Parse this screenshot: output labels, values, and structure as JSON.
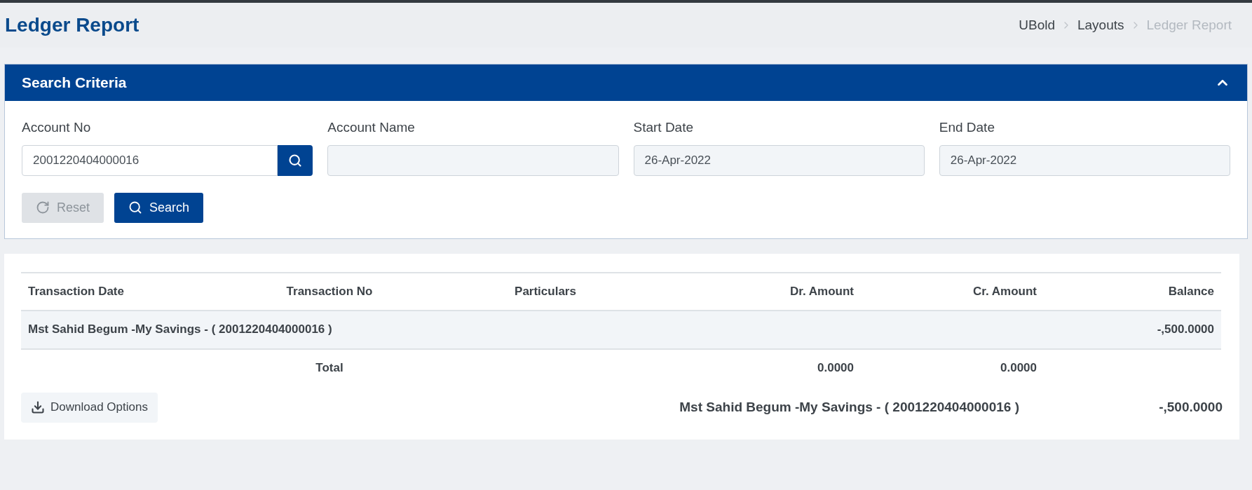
{
  "page_title": "Ledger Report",
  "breadcrumb": [
    {
      "label": "UBold",
      "current": false
    },
    {
      "label": "Layouts",
      "current": false
    },
    {
      "label": "Ledger Report",
      "current": true
    }
  ],
  "search_panel": {
    "title": "Search Criteria",
    "expanded": true,
    "fields": [
      {
        "kind": "lookup",
        "label": "Account No",
        "value": "2001220404000016"
      },
      {
        "kind": "readonly",
        "label": "Account Name"
      },
      {
        "kind": "readonly",
        "label": "Start Date",
        "value": "26-Apr-2022"
      },
      {
        "kind": "readonly",
        "label": "End Date",
        "value": "26-Apr-2022"
      }
    ],
    "buttons": [
      {
        "kind": "reset",
        "label": "Reset",
        "disabled": true
      },
      {
        "kind": "search",
        "label": "Search",
        "disabled": false
      }
    ]
  },
  "table": {
    "columns": [
      "Transaction Date",
      "Transaction No",
      "Particulars",
      "Dr. Amount",
      "Cr. Amount",
      "Balance"
    ],
    "groups": [
      {
        "title": "Mst Sahid Begum -My Savings - ( 2001220404000016 )",
        "balance": "-,500.0000"
      }
    ],
    "total": {
      "label": "Total",
      "dr": "0.0000",
      "cr": "0.0000"
    }
  },
  "download_button": "Download Options",
  "footer": {
    "account": "Mst Sahid Begum -My Savings - ( 2001220404000016 )",
    "balance": "-,500.0000"
  }
}
